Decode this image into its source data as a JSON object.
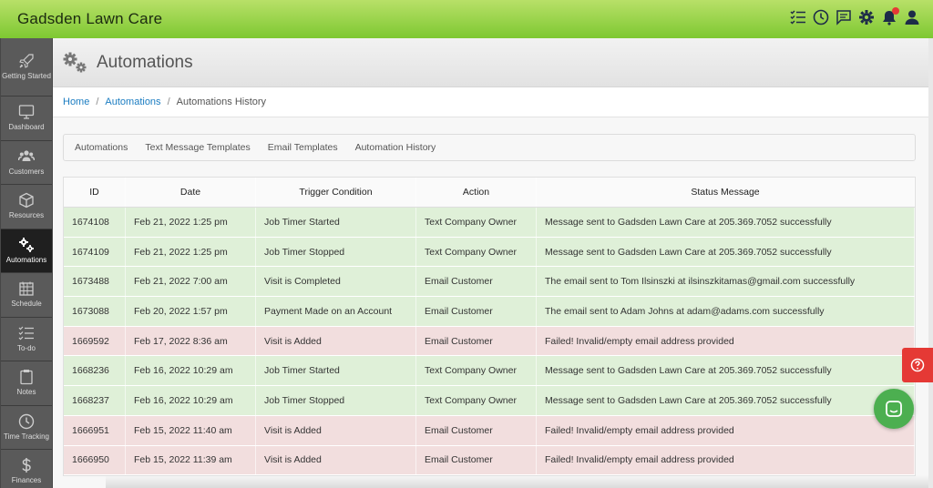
{
  "app": {
    "title": "Gadsden Lawn Care"
  },
  "header_icons": [
    "checklist-icon",
    "clock-icon",
    "chat-icon",
    "gear-icon",
    "bell-icon",
    "user-icon"
  ],
  "sidebar": {
    "items": [
      {
        "label": "Getting Started",
        "icon": "rocket-icon"
      },
      {
        "label": "Dashboard",
        "icon": "monitor-icon"
      },
      {
        "label": "Customers",
        "icon": "users-icon"
      },
      {
        "label": "Resources",
        "icon": "cube-icon"
      },
      {
        "label": "Automations",
        "icon": "gears-icon",
        "active": true
      },
      {
        "label": "Schedule",
        "icon": "calendar-icon"
      },
      {
        "label": "To-do",
        "icon": "checklist-icon"
      },
      {
        "label": "Notes",
        "icon": "clipboard-icon"
      },
      {
        "label": "Time Tracking",
        "icon": "clock-icon"
      },
      {
        "label": "Finances",
        "icon": "dollar-icon"
      }
    ]
  },
  "page": {
    "title": "Automations"
  },
  "breadcrumb": {
    "home": "Home",
    "automations": "Automations",
    "current": "Automations History"
  },
  "tabs": [
    "Automations",
    "Text Message Templates",
    "Email Templates",
    "Automation History"
  ],
  "table": {
    "headers": [
      "ID",
      "Date",
      "Trigger Condition",
      "Action",
      "Status Message"
    ],
    "rows": [
      {
        "id": "1674108",
        "date": "Feb 21, 2022 1:25 pm",
        "trigger": "Job Timer Started",
        "action": "Text Company Owner",
        "status": "Message sent to Gadsden Lawn Care at 205.369.7052 successfully",
        "result": "success"
      },
      {
        "id": "1674109",
        "date": "Feb 21, 2022 1:25 pm",
        "trigger": "Job Timer Stopped",
        "action": "Text Company Owner",
        "status": "Message sent to Gadsden Lawn Care at 205.369.7052 successfully",
        "result": "success"
      },
      {
        "id": "1673488",
        "date": "Feb 21, 2022 7:00 am",
        "trigger": "Visit is Completed",
        "action": "Email Customer",
        "status": "The email sent to Tom Ilsinszki at ilsinszkitamas@gmail.com successfully",
        "result": "success"
      },
      {
        "id": "1673088",
        "date": "Feb 20, 2022 1:57 pm",
        "trigger": "Payment Made on an Account",
        "action": "Email Customer",
        "status": "The email sent to Adam Johns at adam@adams.com successfully",
        "result": "success"
      },
      {
        "id": "1669592",
        "date": "Feb 17, 2022 8:36 am",
        "trigger": "Visit is Added",
        "action": "Email Customer",
        "status": "Failed! Invalid/empty email address provided",
        "result": "failed"
      },
      {
        "id": "1668236",
        "date": "Feb 16, 2022 10:29 am",
        "trigger": "Job Timer Started",
        "action": "Text Company Owner",
        "status": "Message sent to Gadsden Lawn Care at 205.369.7052 successfully",
        "result": "success"
      },
      {
        "id": "1668237",
        "date": "Feb 16, 2022 10:29 am",
        "trigger": "Job Timer Stopped",
        "action": "Text Company Owner",
        "status": "Message sent to Gadsden Lawn Care at 205.369.7052 successfully",
        "result": "success"
      },
      {
        "id": "1666951",
        "date": "Feb 15, 2022 11:40 am",
        "trigger": "Visit is Added",
        "action": "Email Customer",
        "status": "Failed! Invalid/empty email address provided",
        "result": "failed"
      },
      {
        "id": "1666950",
        "date": "Feb 15, 2022 11:39 am",
        "trigger": "Visit is Added",
        "action": "Email Customer",
        "status": "Failed! Invalid/empty email address provided",
        "result": "failed"
      }
    ]
  },
  "colors": {
    "accent": "#7ec832",
    "success_row": "#dff0d8",
    "failed_row": "#f2dede",
    "help": "#e53935",
    "chat": "#4caf50",
    "link": "#1a7cc1"
  }
}
